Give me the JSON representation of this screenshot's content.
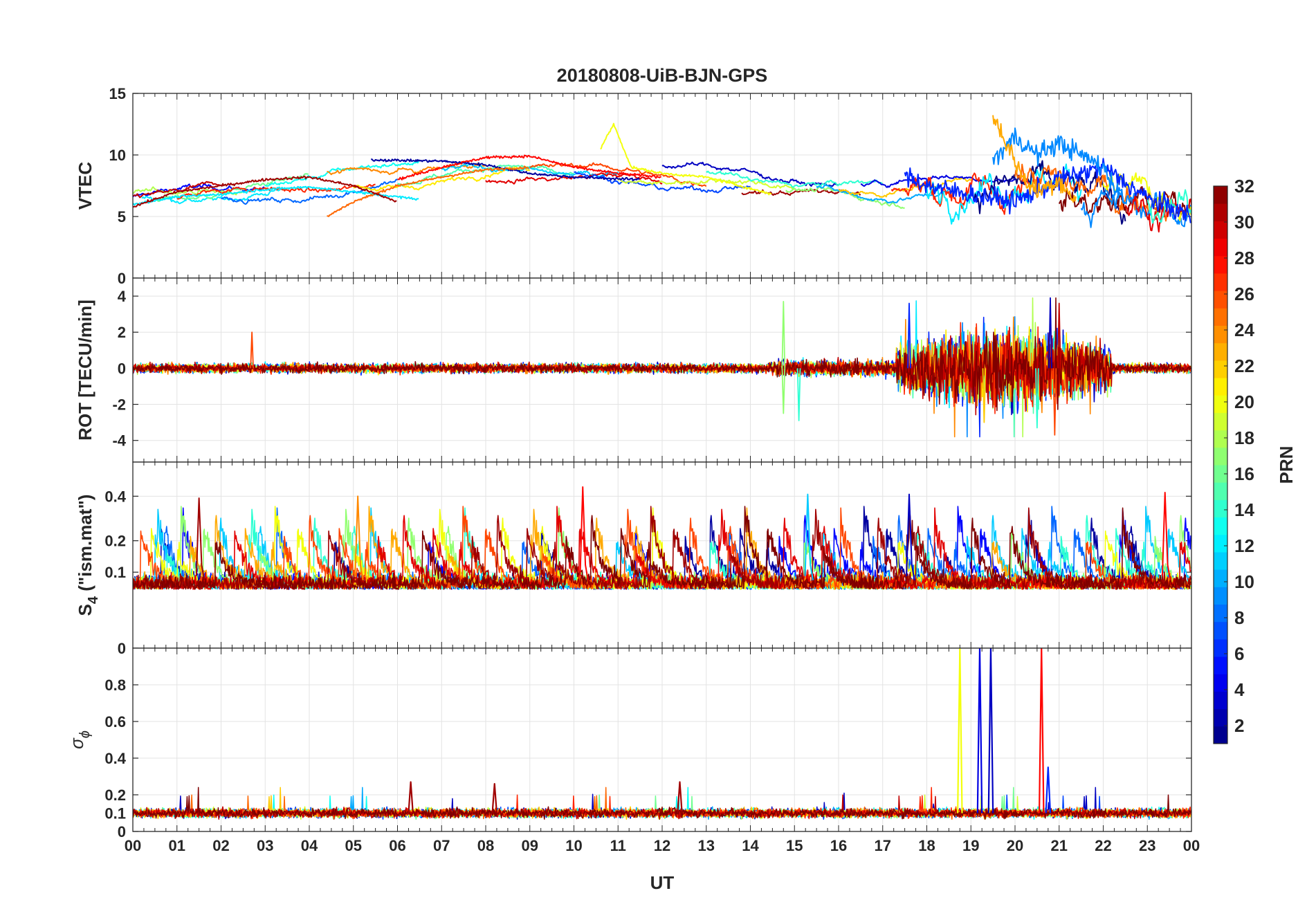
{
  "title": "20180808-UiB-BJN-GPS",
  "xlabel": "UT",
  "x_ticks": [
    "00",
    "01",
    "02",
    "03",
    "04",
    "05",
    "06",
    "07",
    "08",
    "09",
    "10",
    "11",
    "12",
    "13",
    "14",
    "15",
    "16",
    "17",
    "18",
    "19",
    "20",
    "21",
    "22",
    "23",
    "00"
  ],
  "panels": [
    {
      "ylabel": "VTEC",
      "ylabel_sub": "",
      "ylabel_suffix": "",
      "yticks": [
        "0",
        "5",
        "10",
        "15"
      ]
    },
    {
      "ylabel": "ROT [TECU/min]",
      "ylabel_sub": "",
      "ylabel_suffix": "",
      "yticks": [
        "-4",
        "-2",
        "0",
        "2",
        "4"
      ]
    },
    {
      "ylabel": "S",
      "ylabel_sub": "4",
      "ylabel_suffix": " (\"ism.mat\")",
      "yticks": [
        "0",
        "0.1",
        "0.2",
        "0.4"
      ]
    },
    {
      "ylabel": "σ",
      "ylabel_sub": "ϕ",
      "ylabel_suffix": "",
      "yticks": [
        "0",
        "0.1",
        "0.2",
        "0.4",
        "0.6",
        "0.8"
      ]
    }
  ],
  "colorbar": {
    "label": "PRN",
    "ticks": [
      "2",
      "4",
      "6",
      "8",
      "10",
      "12",
      "14",
      "16",
      "18",
      "20",
      "22",
      "24",
      "26",
      "28",
      "30",
      "32"
    ],
    "colormap": "jet",
    "range": [
      1,
      32
    ]
  },
  "chart_data": [
    {
      "type": "line",
      "title": "20180808-UiB-BJN-GPS",
      "xlabel": "UT",
      "ylabel": "VTEC",
      "xlim": [
        0,
        24
      ],
      "ylim": [
        0,
        15
      ],
      "grid": true,
      "color_by": "PRN",
      "series": [
        {
          "name": "PRN 2",
          "x": [
            5.4,
            7,
            8,
            9,
            10,
            11.5
          ],
          "values": [
            9.6,
            9.5,
            9.2,
            8.5,
            8.2,
            8.0
          ]
        },
        {
          "name": "PRN 6",
          "x": [
            17.5,
            18,
            19,
            20,
            21,
            22,
            23,
            24
          ],
          "values": [
            8.5,
            7.5,
            6.8,
            6.2,
            8.0,
            9.0,
            6.5,
            5.0
          ]
        },
        {
          "name": "PRN 9",
          "x": [
            19.5,
            20,
            20.5,
            21,
            21.5,
            22,
            22.5
          ],
          "values": [
            9.5,
            11.5,
            10.0,
            11.0,
            10.0,
            9.0,
            6.0
          ]
        },
        {
          "name": "PRN 12",
          "x": [
            0,
            1,
            2,
            3,
            4,
            5,
            6.5
          ],
          "values": [
            6.0,
            6.6,
            6.8,
            7.2,
            7.4,
            7.0,
            6.4
          ]
        },
        {
          "name": "PRN 20",
          "x": [
            10.6,
            10.9,
            11.3,
            12,
            13,
            14.5
          ],
          "values": [
            10.5,
            12.5,
            9.0,
            8.5,
            8.2,
            6.8
          ]
        },
        {
          "name": "PRN 23",
          "x": [
            19.5,
            19.8,
            20.2,
            20.5,
            21,
            21.4
          ],
          "values": [
            13.2,
            11.0,
            8.0,
            7.0,
            8.0,
            6.0
          ]
        },
        {
          "name": "PRN 25",
          "x": [
            4.4,
            5,
            6,
            7,
            8,
            9
          ],
          "values": [
            5.0,
            6.2,
            7.5,
            8.2,
            8.8,
            9.0
          ]
        },
        {
          "name": "PRN 28",
          "x": [
            6,
            7,
            8,
            9,
            10,
            11,
            12
          ],
          "values": [
            8.0,
            9.0,
            9.8,
            9.9,
            9.0,
            8.5,
            8.2
          ]
        },
        {
          "name": "PRN 31",
          "x": [
            0,
            1,
            2,
            3,
            4,
            5,
            6
          ],
          "values": [
            5.8,
            7.0,
            7.5,
            8.0,
            8.2,
            7.5,
            6.2
          ]
        }
      ]
    },
    {
      "type": "line",
      "xlabel": "UT",
      "ylabel": "ROT [TECU/min]",
      "xlim": [
        0,
        24
      ],
      "ylim": [
        -5.2,
        5
      ],
      "grid": true,
      "color_by": "PRN",
      "description_values": {
        "baseline": 0,
        "max_observed": 3.9,
        "min_observed": -3.8,
        "disturbed_interval_UT": [
          17.3,
          22.2
        ]
      }
    },
    {
      "type": "line",
      "xlabel": "UT",
      "ylabel": "S4 (\"ism.mat\")",
      "xlim": [
        0,
        24
      ],
      "ylim": [
        0,
        0.6
      ],
      "grid": true,
      "color_by": "PRN",
      "y_scale": "nonlinear (sqrt-like)",
      "description_values": {
        "baseline": 0.07,
        "notable_peaks": [
          {
            "x": 10.2,
            "value": 0.45
          },
          {
            "x": 5.1,
            "value": 0.4
          },
          {
            "x": 15.3,
            "value": 0.41
          },
          {
            "x": 23.4,
            "value": 0.42
          },
          {
            "x": 17.6,
            "value": 0.41
          },
          {
            "x": 1.5,
            "value": 0.39
          }
        ]
      }
    },
    {
      "type": "line",
      "xlabel": "UT",
      "ylabel": "σϕ",
      "xlim": [
        0,
        24
      ],
      "ylim": [
        0,
        1
      ],
      "grid": true,
      "color_by": "PRN",
      "description_values": {
        "baseline": 0.1,
        "notable_peaks": [
          {
            "x": 18.75,
            "value": 1.0
          },
          {
            "x": 19.2,
            "value": 1.0
          },
          {
            "x": 19.45,
            "value": 1.0
          },
          {
            "x": 20.6,
            "value": 1.0
          },
          {
            "x": 20.75,
            "value": 0.35
          },
          {
            "x": 6.3,
            "value": 0.27
          },
          {
            "x": 8.2,
            "value": 0.26
          },
          {
            "x": 12.4,
            "value": 0.27
          }
        ]
      }
    }
  ]
}
